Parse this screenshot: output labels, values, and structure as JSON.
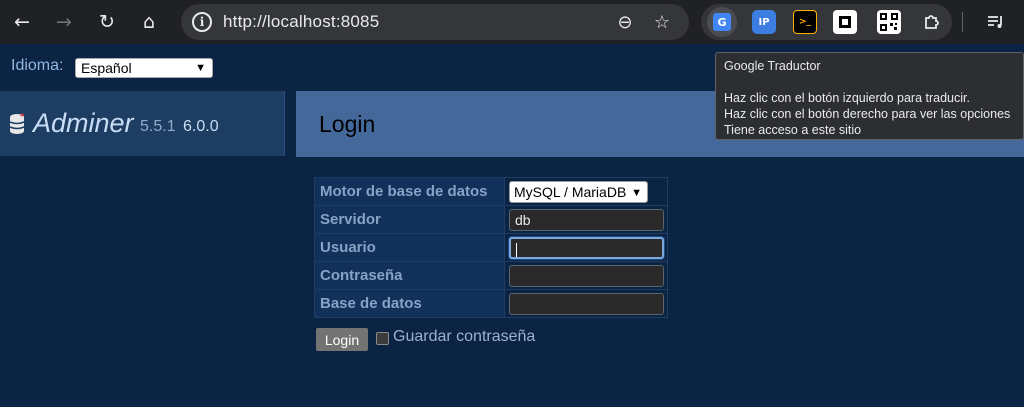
{
  "browser": {
    "url": "http://localhost:8085",
    "back_icon": "←",
    "forward_icon": "→",
    "reload_icon": "↻",
    "home_icon": "⌂",
    "zoom_icon": "⊖",
    "star_icon": "☆",
    "extensions": {
      "translate_glyph": "G",
      "ip_glyph": "IP",
      "ssh_glyph": ">_"
    }
  },
  "language": {
    "label": "Idioma:",
    "selected": "Español"
  },
  "brand": {
    "name": "Adminer",
    "version_current": "5.5.1",
    "version_new": "6.0.0"
  },
  "page": {
    "title": "Login"
  },
  "form": {
    "rows": [
      {
        "label": "Motor de base de datos",
        "value": "MySQL / MariaDB"
      },
      {
        "label": "Servidor",
        "value": "db"
      },
      {
        "label": "Usuario",
        "value": ""
      },
      {
        "label": "Contraseña",
        "value": ""
      },
      {
        "label": "Base de datos",
        "value": ""
      }
    ],
    "submit_label": "Login",
    "save_password_label": "Guardar contraseña"
  },
  "tooltip": {
    "title": "Google Traductor",
    "line1": "Haz clic con el botón izquierdo para traducir.",
    "line2": "Haz clic con el botón derecho para ver las opciones",
    "line3": "Tiene acceso a este sitio"
  }
}
